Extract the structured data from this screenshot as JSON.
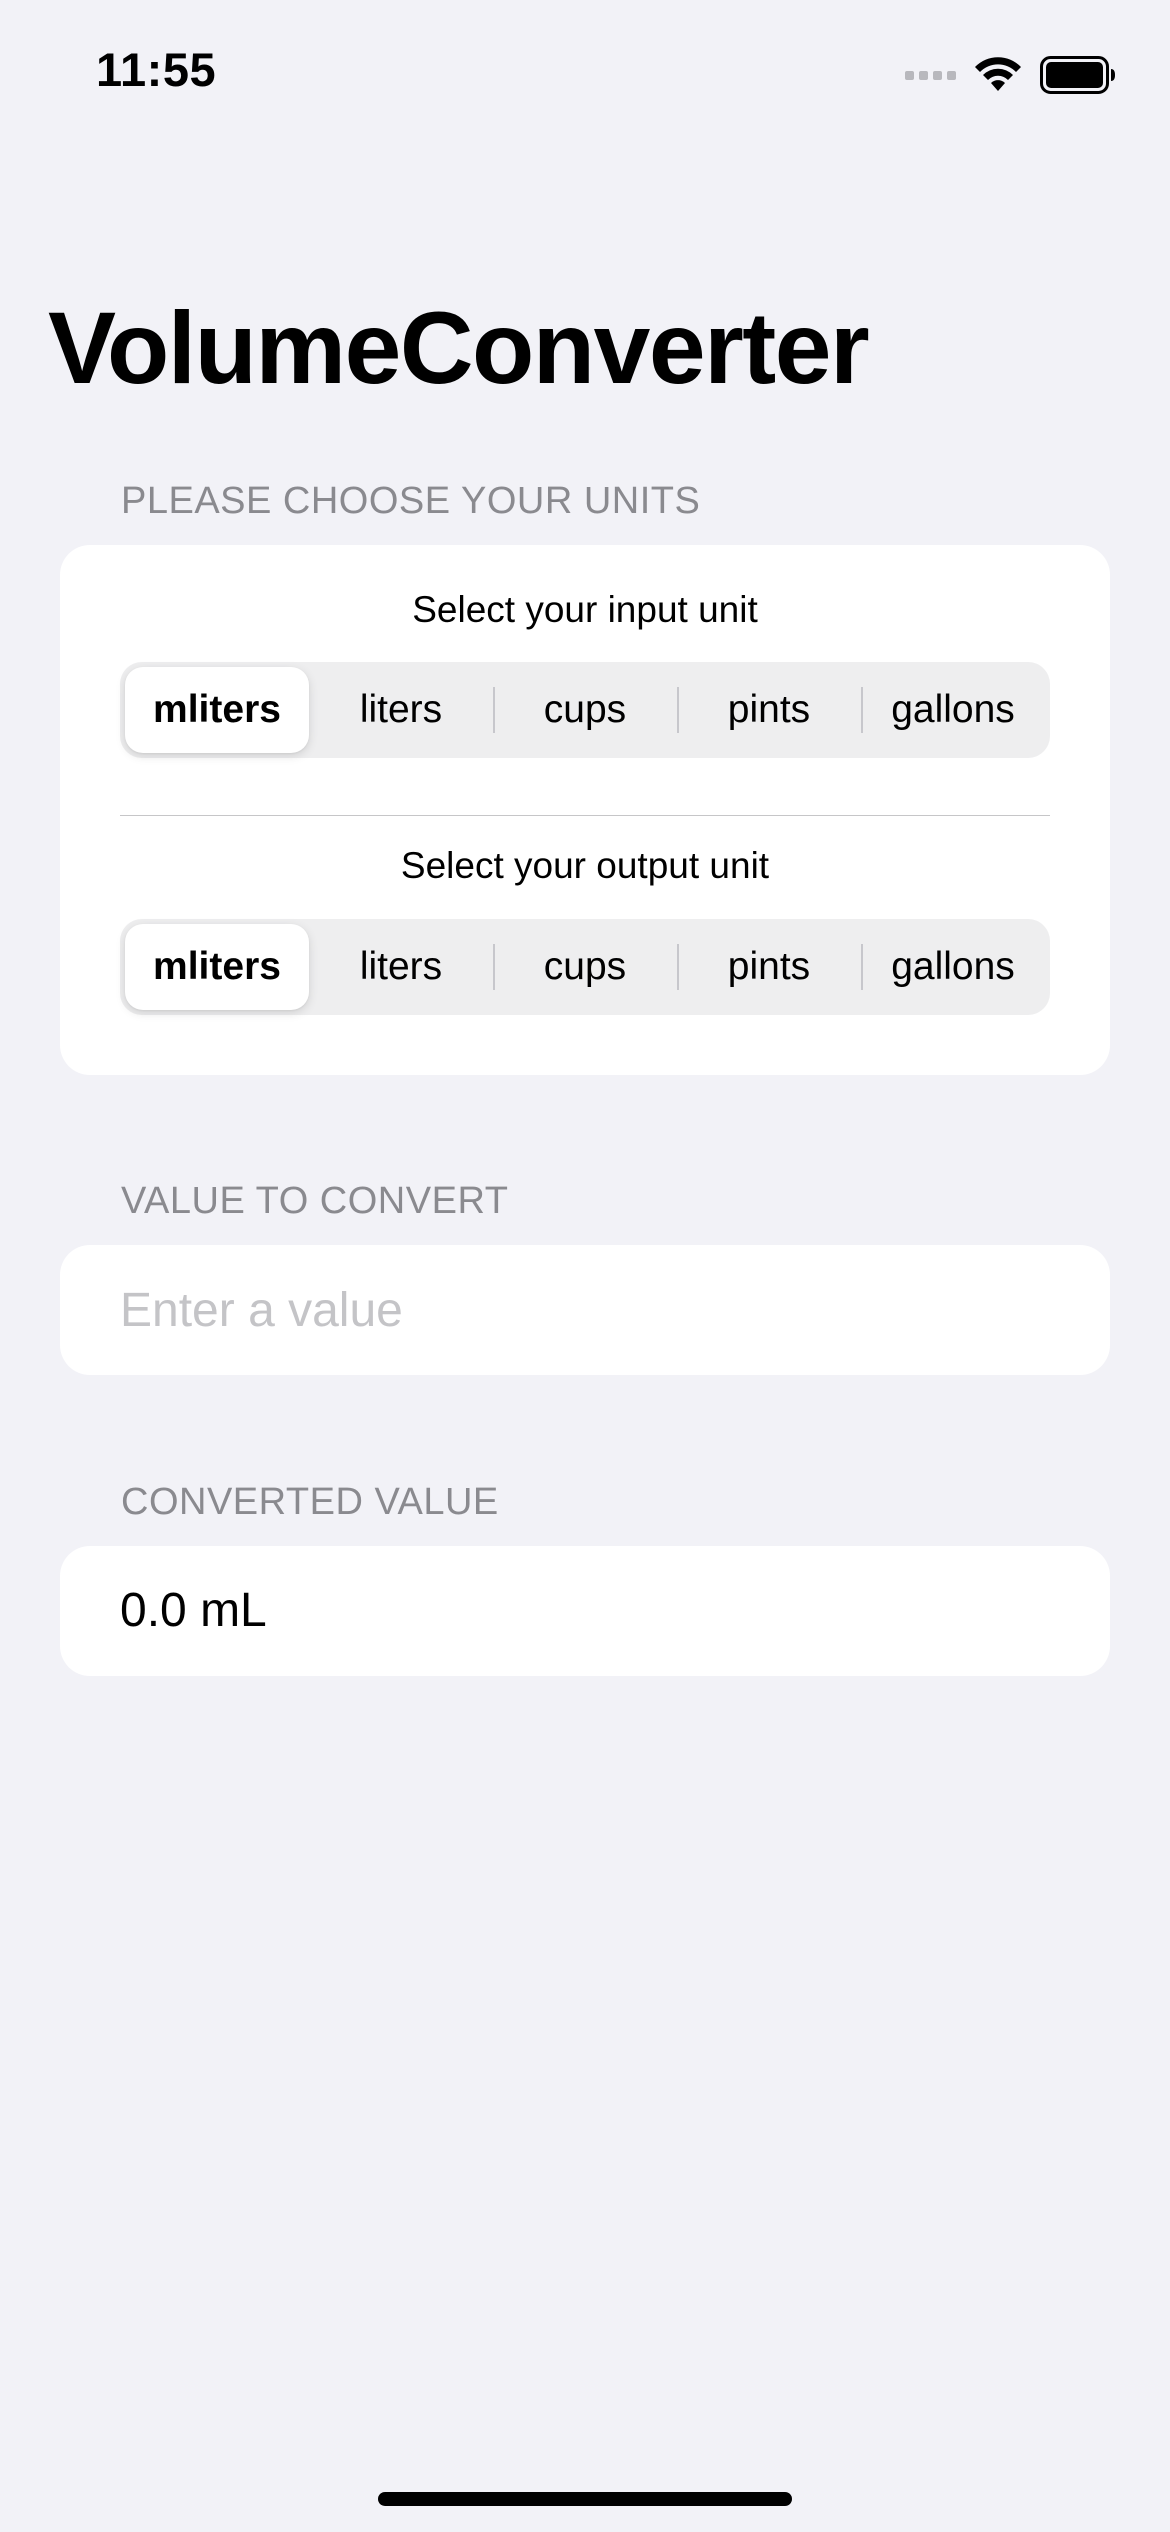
{
  "status_bar": {
    "time": "11:55"
  },
  "app": {
    "title": "VolumeConverter"
  },
  "units_section": {
    "header": "PLEASE CHOOSE YOUR UNITS",
    "input_picker": {
      "label": "Select your input unit",
      "options": [
        "mliters",
        "liters",
        "cups",
        "pints",
        "gallons"
      ],
      "selected": "mliters"
    },
    "output_picker": {
      "label": "Select your output unit",
      "options": [
        "mliters",
        "liters",
        "cups",
        "pints",
        "gallons"
      ],
      "selected": "mliters"
    }
  },
  "value_section": {
    "header": "VALUE TO CONVERT",
    "placeholder": "Enter a value",
    "value": ""
  },
  "result_section": {
    "header": "CONVERTED VALUE",
    "value": "0.0 mL"
  },
  "colors": {
    "background": "#f2f2f7",
    "card": "#ffffff",
    "section_header": "#8a8a8f",
    "placeholder": "#c4c4c7"
  }
}
